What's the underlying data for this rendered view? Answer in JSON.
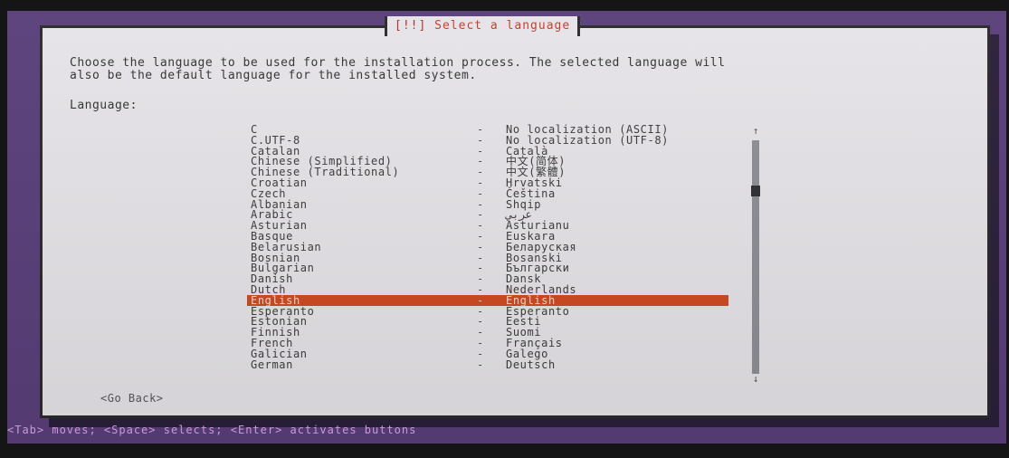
{
  "dialog": {
    "title_brackets": "[!!]",
    "title": "Select a language",
    "description": "Choose the language to be used for the installation process. The selected language will\nalso be the default language for the installed system.",
    "language_label": "Language:",
    "go_back": "<Go Back>"
  },
  "languages": [
    {
      "name": "C",
      "native": "No localization (ASCII)"
    },
    {
      "name": "C.UTF-8",
      "native": "No localization (UTF-8)"
    },
    {
      "name": "Catalan",
      "native": "Català"
    },
    {
      "name": "Chinese (Simplified)",
      "native": "中文(简体)"
    },
    {
      "name": "Chinese (Traditional)",
      "native": "中文(繁體)"
    },
    {
      "name": "Croatian",
      "native": "Hrvatski"
    },
    {
      "name": "Czech",
      "native": "Čeština"
    },
    {
      "name": "Albanian",
      "native": "Shqip"
    },
    {
      "name": "Arabic",
      "native": "عربي"
    },
    {
      "name": "Asturian",
      "native": "Asturianu"
    },
    {
      "name": "Basque",
      "native": "Euskara"
    },
    {
      "name": "Belarusian",
      "native": "Беларуская"
    },
    {
      "name": "Bosnian",
      "native": "Bosanski"
    },
    {
      "name": "Bulgarian",
      "native": "Български"
    },
    {
      "name": "Danish",
      "native": "Dansk"
    },
    {
      "name": "Dutch",
      "native": "Nederlands"
    },
    {
      "name": "English",
      "native": "English"
    },
    {
      "name": "Esperanto",
      "native": "Esperanto"
    },
    {
      "name": "Estonian",
      "native": "Eesti"
    },
    {
      "name": "Finnish",
      "native": "Suomi"
    },
    {
      "name": "French",
      "native": "Français"
    },
    {
      "name": "Galician",
      "native": "Galego"
    },
    {
      "name": "German",
      "native": "Deutsch"
    }
  ],
  "separator": "-",
  "selected_language": "English",
  "scrollbar": {
    "up_arrow": "↑",
    "down_arrow": "↓"
  },
  "statusbar": "<Tab> moves; <Space> selects; <Enter> activates buttons",
  "colors": {
    "background": "#5a3f7a",
    "dialog": "#e6e4e8",
    "selection": "#cf4a22",
    "title_text": "#c63a2a",
    "statusbar_text": "#d7a7e8"
  }
}
